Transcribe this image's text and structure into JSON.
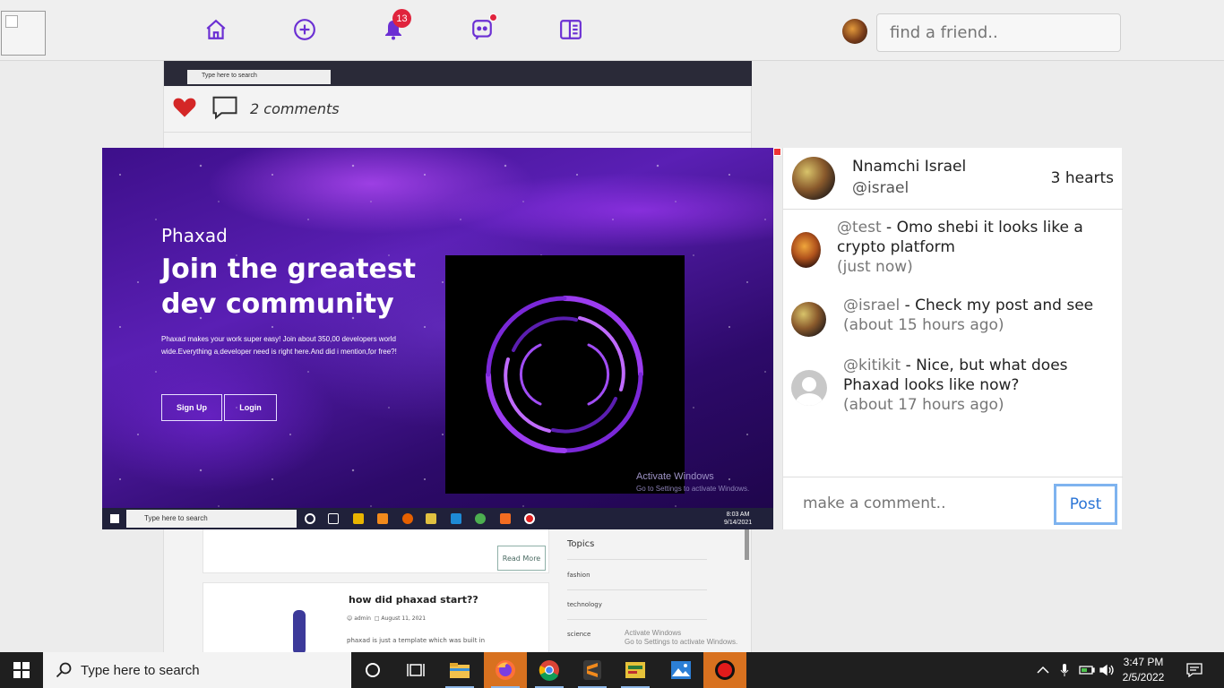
{
  "nav": {
    "notification_count": "13",
    "search_placeholder": "find a friend.."
  },
  "feed": {
    "comments_label": "2 comments",
    "screenshot_search_text": "Type here to search",
    "read_more": "Read More",
    "post_title": "how did phaxad start??",
    "post_author": "admin",
    "post_date": "August 11, 2021",
    "post_excerpt": "phaxad is just a template which was built in",
    "topics_heading": "Topics",
    "topics": [
      "fashion",
      "technology",
      "science"
    ],
    "activate_title": "Activate Windows",
    "activate_sub": "Go to Settings to activate Windows."
  },
  "modal": {
    "brand": "Phaxad",
    "headline": "Join the greatest dev community",
    "body": "Phaxad makes your work super easy! Join about 350,00 developers world wide.Everything a developer need is right here.And did i mention,for free?!",
    "signup": "Sign Up",
    "login": "Login",
    "activate_title": "Activate Windows",
    "activate_sub": "Go to Settings to activate Windows.",
    "taskbar_search": "Type here to search",
    "clock_time": "8:03 AM",
    "clock_date": "9/14/2021"
  },
  "panel": {
    "author_name": "Nnamchi Israel",
    "author_handle": "@israel",
    "hearts": "3 hearts",
    "comments": [
      {
        "handle": "@test",
        "text": " - Omo shebi it looks like a crypto platform",
        "time": "(just now)"
      },
      {
        "handle": "@israel",
        "text": " - Check my post and see",
        "time": "(about 15 hours ago)"
      },
      {
        "handle": "@kitikit",
        "text": " - Nice, but what does Phaxad looks like now?",
        "time": "(about 17 hours ago)"
      }
    ],
    "comment_placeholder": "make a comment..",
    "post_label": "Post"
  },
  "taskbar": {
    "search_text": "Type here to search",
    "time": "3:47 PM",
    "date": "2/5/2022"
  },
  "colors": {
    "accent": "#6b2fd3",
    "badge": "#e0243d",
    "post_button": "#2a74d6"
  }
}
